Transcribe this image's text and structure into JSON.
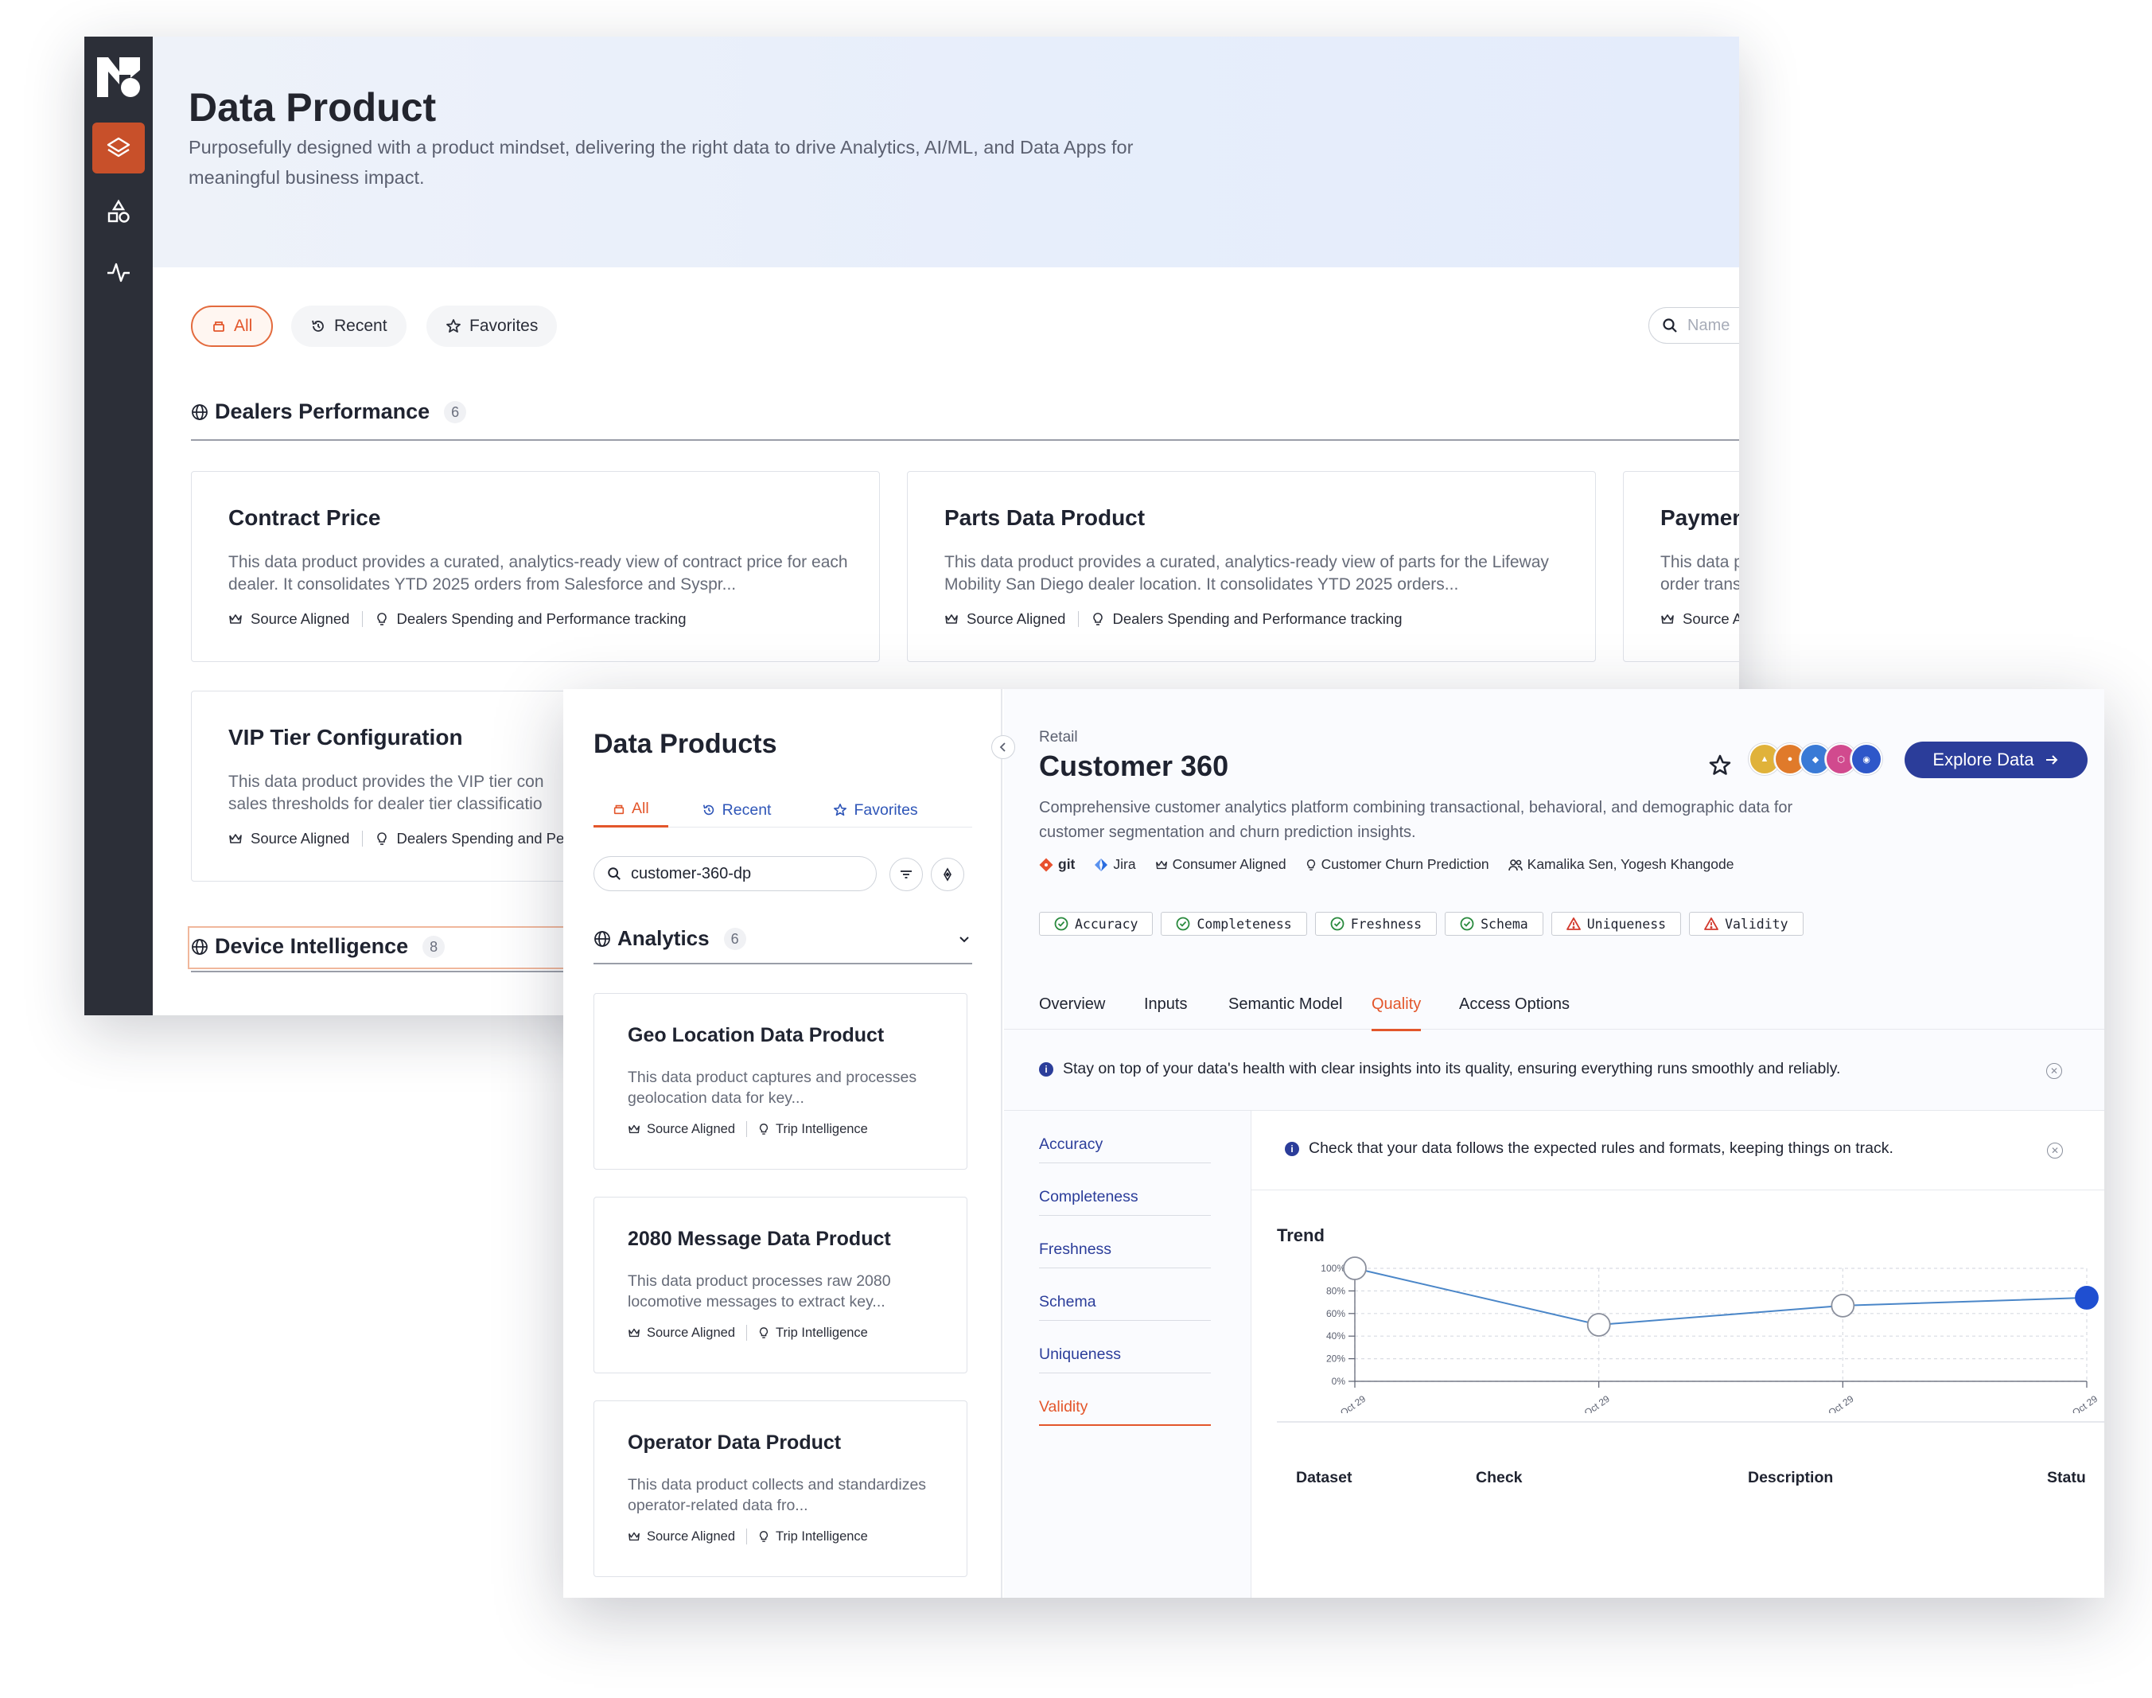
{
  "back": {
    "title": "Data Product",
    "description": "Purposefully designed with a product mindset, delivering the right data to drive Analytics, AI/ML, and Data Apps for meaningful business impact.",
    "filters": {
      "all": "All",
      "recent": "Recent",
      "favorites": "Favorites"
    },
    "search_placeholder": "Name",
    "groups": [
      {
        "name": "Dealers Performance",
        "count": "6"
      },
      {
        "name": "Device Intelligence",
        "count": "8"
      }
    ],
    "cards": [
      {
        "title": "Contract Price",
        "desc": "This data product provides a curated, analytics-ready view of contract price for each dealer. It consolidates YTD 2025 orders from Salesforce and Syspr...",
        "type": "Source Aligned",
        "usecase": "Dealers Spending and Performance tracking"
      },
      {
        "title": "Parts Data Product",
        "desc": "This data product provides a curated, analytics-ready view of parts for the Lifeway Mobility San Diego dealer location. It consolidates YTD 2025 orders...",
        "type": "Source Aligned",
        "usecase": "Dealers Spending and Performance tracking"
      },
      {
        "title": "Paymen",
        "desc": "This data p order trans",
        "type": "Source A",
        "usecase": ""
      },
      {
        "title": "VIP Tier Configuration",
        "desc": "This data product provides the VIP tier con sales thresholds for dealer tier classificatio",
        "type": "Source Aligned",
        "usecase": "Dealers Spending and Per"
      }
    ]
  },
  "front": {
    "left": {
      "title": "Data Products",
      "tabs": {
        "all": "All",
        "recent": "Recent",
        "favorites": "Favorites"
      },
      "search_value": "customer-360-dp",
      "group": {
        "name": "Analytics",
        "count": "6"
      },
      "cards": [
        {
          "title": "Geo Location Data Product",
          "desc": "This data product captures and processes geolocation data for key...",
          "type": "Source Aligned",
          "usecase": "Trip Intelligence"
        },
        {
          "title": "2080 Message Data Product",
          "desc": "This data product processes raw 2080 locomotive messages to extract key...",
          "type": "Source Aligned",
          "usecase": "Trip Intelligence"
        },
        {
          "title": "Operator Data Product",
          "desc": "This data product collects and standardizes operator-related data fro...",
          "type": "Source Aligned",
          "usecase": "Trip Intelligence"
        }
      ]
    },
    "detail": {
      "category": "Retail",
      "title": "Customer 360",
      "description": "Comprehensive customer analytics platform combining transactional, behavioral, and demographic data for customer segmentation and churn prediction insights.",
      "meta": {
        "git": "git",
        "jira": "Jira",
        "type": "Consumer Aligned",
        "usecase": "Customer Churn Prediction",
        "owners": "Kamalika Sen, Yogesh Khangode"
      },
      "explore_label": "Explore Data",
      "tools": [
        {
          "icon": "tool-icon-1",
          "color": "#e0b23a"
        },
        {
          "icon": "tool-icon-2",
          "color": "#e07a2a"
        },
        {
          "icon": "tool-icon-3",
          "color": "#3a7ad6"
        },
        {
          "icon": "tool-icon-4",
          "color": "#d14a8e"
        },
        {
          "icon": "tool-icon-5",
          "color": "#2e57c9"
        }
      ],
      "quality_checks": [
        {
          "label": "Accuracy",
          "status": "pass"
        },
        {
          "label": "Completeness",
          "status": "pass"
        },
        {
          "label": "Freshness",
          "status": "pass"
        },
        {
          "label": "Schema",
          "status": "pass"
        },
        {
          "label": "Uniqueness",
          "status": "warn"
        },
        {
          "label": "Validity",
          "status": "warn"
        }
      ],
      "tabs": [
        "Overview",
        "Inputs",
        "Semantic Model",
        "Quality",
        "Access Options"
      ],
      "selected_tab": "Quality",
      "info": "Stay on top of your data's health with clear insights into its quality, ensuring everything runs smoothly and reliably.",
      "quality_nav": [
        "Accuracy",
        "Completeness",
        "Freshness",
        "Schema",
        "Uniqueness",
        "Validity"
      ],
      "selected_quality": "Validity",
      "sub_info": "Check that your data follows the expected rules and formats, keeping things on track.",
      "trend_label": "Trend",
      "table_headers": [
        "Dataset",
        "Check",
        "Description",
        "Statu"
      ]
    }
  },
  "chart_data": {
    "type": "line",
    "categories": [
      "Oct 29",
      "Oct 29",
      "Oct 29",
      "Oct 29"
    ],
    "values": [
      100,
      50,
      67,
      74
    ],
    "y_ticks": [
      "0%",
      "20%",
      "40%",
      "60%",
      "80%",
      "100%"
    ],
    "ylim": [
      0,
      100
    ],
    "grid": true,
    "color": "#4a86c8",
    "title": ""
  }
}
